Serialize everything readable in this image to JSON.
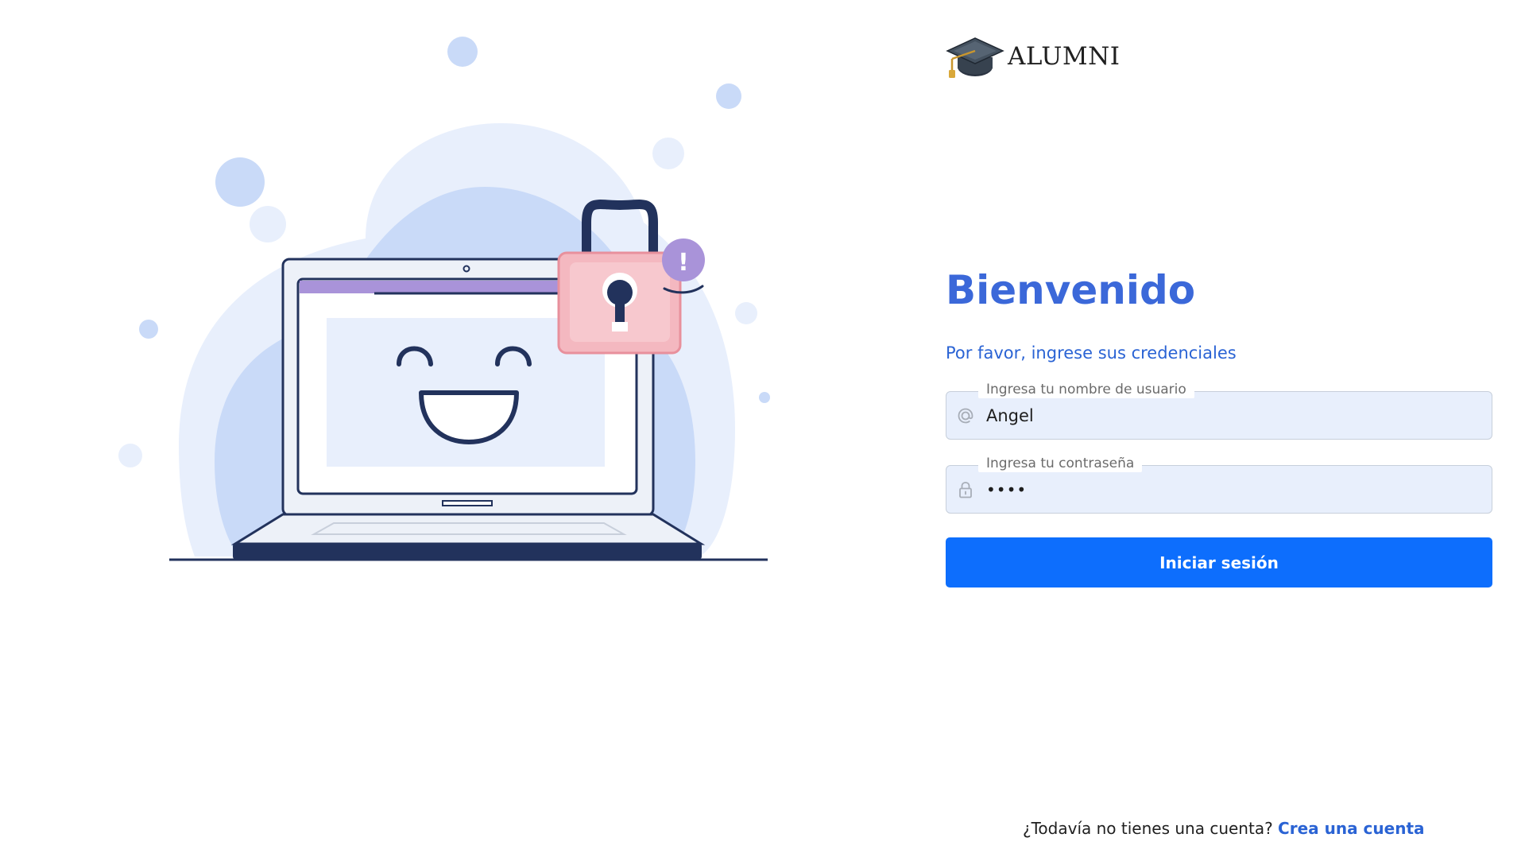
{
  "logo": {
    "text": "ALUMNI",
    "icon": "graduation-cap-icon"
  },
  "login": {
    "title": "Bienvenido",
    "subtitle": "Por favor, ingrese sus credenciales",
    "username": {
      "label": "Ingresa tu nombre de usuario",
      "value": "Angel",
      "icon": "at-sign-icon"
    },
    "password": {
      "label": "Ingresa tu contraseña",
      "value": "••••",
      "icon": "lock-icon"
    },
    "submit_label": "Iniciar sesión"
  },
  "footer": {
    "prompt": "¿Todavía no tienes una cuenta?",
    "link": "Crea una cuenta"
  },
  "colors": {
    "accent": "#3b68d9",
    "button": "#0d6efd",
    "field_bg": "#e8effc",
    "illustration_blue": "#c9daf8",
    "illustration_pink": "#f4b8c0",
    "illustration_navy": "#22325c",
    "illustration_purple": "#a993d9"
  }
}
